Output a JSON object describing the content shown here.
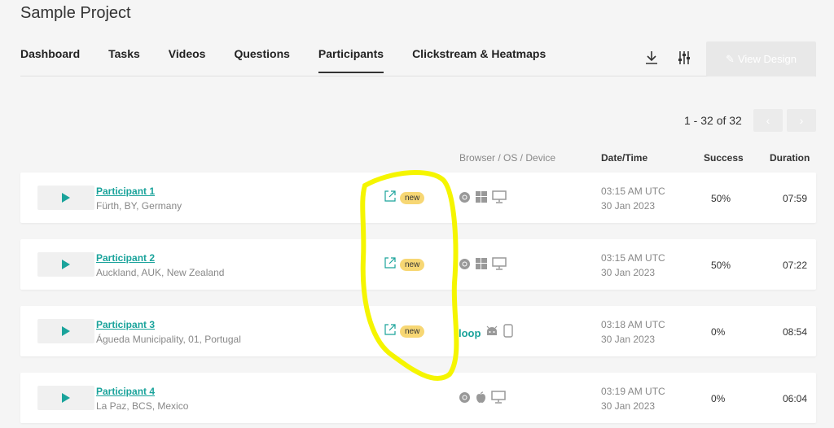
{
  "project_title": "Sample Project",
  "tabs": [
    {
      "label": "Dashboard"
    },
    {
      "label": "Tasks"
    },
    {
      "label": "Videos"
    },
    {
      "label": "Questions"
    },
    {
      "label": "Participants",
      "active": true
    },
    {
      "label": "Clickstream & Heatmaps"
    }
  ],
  "toolbar": {
    "download_icon": "download-icon",
    "settings_icon": "sliders-icon",
    "view_design_label": "View Design"
  },
  "pagination": {
    "text": "1 - 32 of 32",
    "prev_label": "‹",
    "next_label": "›"
  },
  "columns": {
    "browser_os_device": "Browser / OS / Device",
    "datetime": "Date/Time",
    "success": "Success",
    "duration": "Duration"
  },
  "participants": [
    {
      "name": "Participant 1",
      "location": "Fürth, BY, Germany",
      "badge": "new",
      "browser": "chrome",
      "os": "windows",
      "device": "desktop",
      "time": "03:15 AM UTC",
      "date": "30 Jan 2023",
      "success": "50%",
      "duration": "07:59"
    },
    {
      "name": "Participant 2",
      "location": "Auckland, AUK, New Zealand",
      "badge": "new",
      "browser": "chrome",
      "os": "windows",
      "device": "desktop",
      "time": "03:15 AM UTC",
      "date": "30 Jan 2023",
      "success": "50%",
      "duration": "07:22"
    },
    {
      "name": "Participant 3",
      "location": "Águeda Municipality, 01, Portugal",
      "badge": "new",
      "browser": "loop",
      "browser_label": "loop",
      "os": "android",
      "device": "mobile",
      "time": "03:18 AM UTC",
      "date": "30 Jan 2023",
      "success": "0%",
      "duration": "08:54"
    },
    {
      "name": "Participant 4",
      "location": "La Paz, BCS, Mexico",
      "badge": "",
      "browser": "chrome",
      "os": "apple",
      "device": "desktop",
      "time": "03:19 AM UTC",
      "date": "30 Jan 2023",
      "success": "0%",
      "duration": "06:04"
    }
  ],
  "colors": {
    "accent": "#1aa39b",
    "badge": "#f7d774",
    "highlight": "#f5f500"
  }
}
